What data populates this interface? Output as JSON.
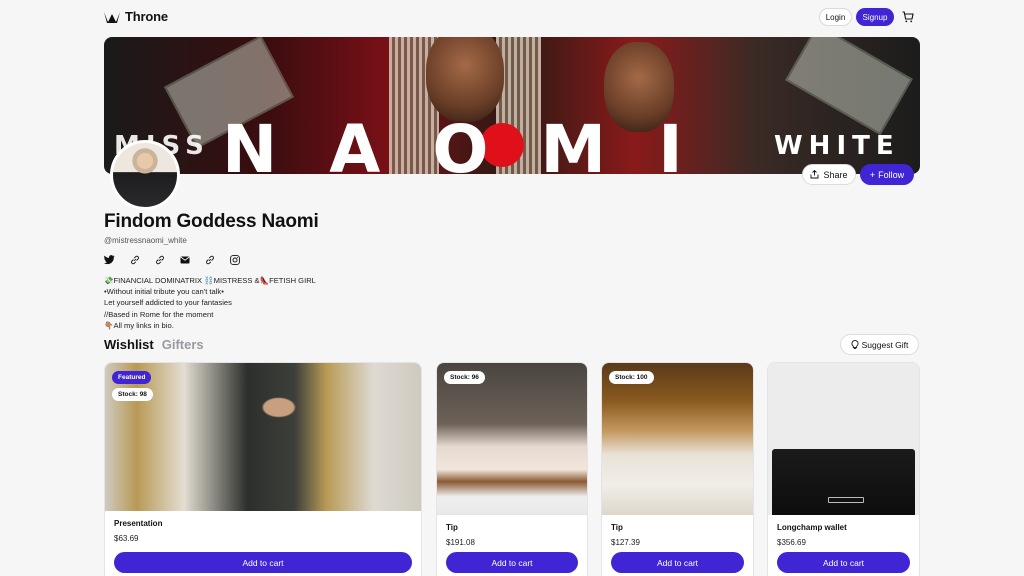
{
  "nav": {
    "brand": "Throne",
    "login_label": "Login",
    "signup_label": "Signup"
  },
  "banner": {
    "word_left": "MISS",
    "word_main": "NAOMI",
    "word_right": "WHITE"
  },
  "profile": {
    "share_label": "Share",
    "follow_label": "Follow",
    "name": "Findom Goddess Naomi",
    "handle": "@mistressnaomi_white",
    "socials": [
      "twitter-icon",
      "link-icon",
      "link-icon",
      "mail-icon",
      "link-icon",
      "instagram-icon"
    ],
    "bio": [
      "💸FINANCIAL DOMINATRIX ⛓️MISTRESS &👠FETISH GIRL",
      "•Without initial tribute you can't talk•",
      "Let yourself addicted to your fantasies",
      "//Based in Rome for the moment",
      "👇🏽All my links in bio."
    ]
  },
  "tabs": {
    "wishlist": "Wishlist",
    "gifters": "Gifters",
    "suggest_label": "Suggest Gift"
  },
  "products": [
    {
      "title": "Presentation",
      "price": "$63.69",
      "featured": "Featured",
      "stock": "Stock: 98",
      "cta": "Add to cart"
    },
    {
      "title": "Tip",
      "price": "$191.08",
      "stock": "Stock: 96",
      "cta": "Add to cart"
    },
    {
      "title": "Tip",
      "price": "$127.39",
      "stock": "Stock: 100",
      "cta": "Add to cart"
    },
    {
      "title": "Longchamp wallet",
      "price": "$356.69",
      "cta": "Add to cart"
    }
  ],
  "colors": {
    "accent": "#3f25d3",
    "background": "#f6f6f7"
  }
}
